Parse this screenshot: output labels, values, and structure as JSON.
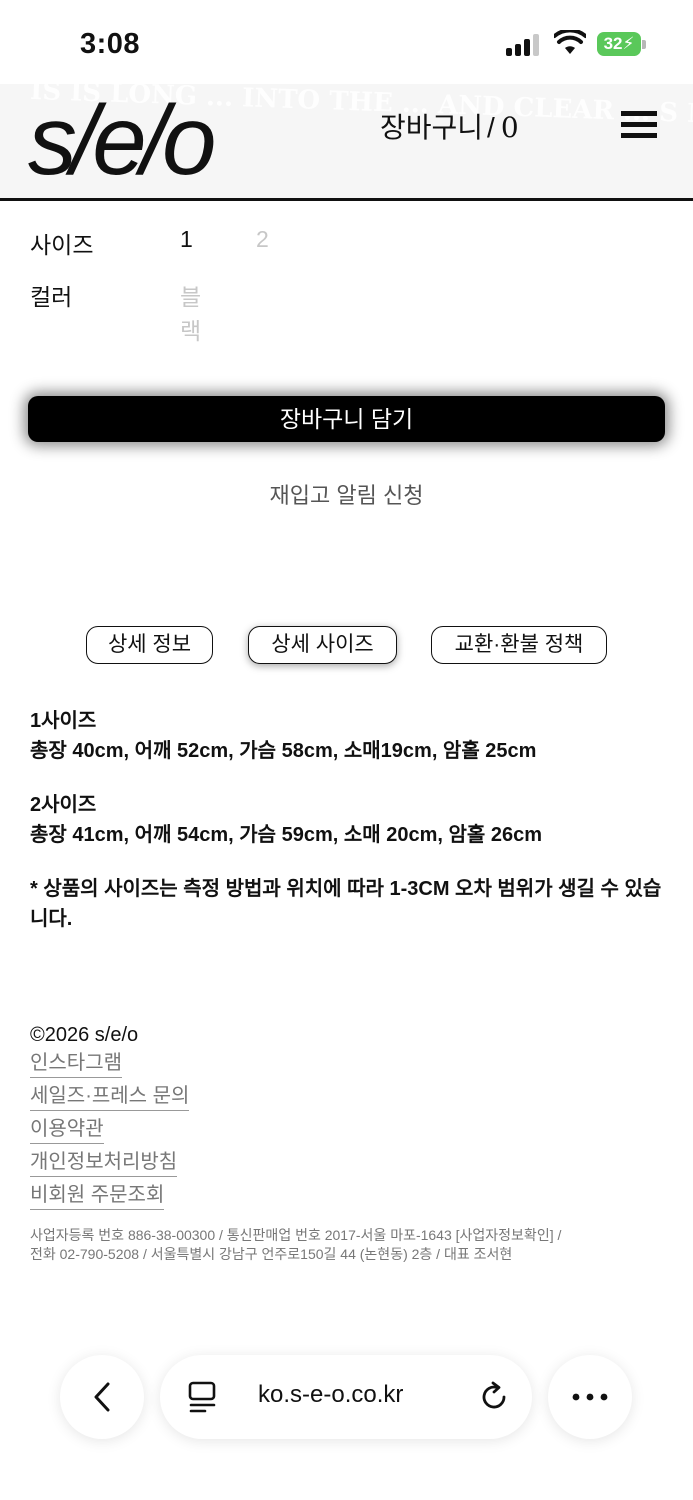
{
  "status_bar": {
    "time": "3:08",
    "battery": "32",
    "battery_color": "#5ac85a",
    "icons": [
      "signal-icon",
      "wifi-icon",
      "battery-icon"
    ]
  },
  "header": {
    "logo": "s/e/o",
    "cart_label": "장바구니",
    "cart_separator": "/",
    "cart_count": "0",
    "background_text": "IS IS LONG ... INTO THE ... AND CLEAR ... S MEANS NOTHI IG MAYBE.",
    "menu_icon": "hamburger-icon"
  },
  "options": {
    "size_label": "사이즈",
    "size_values": [
      "1",
      "2"
    ],
    "color_label": "컬러",
    "color_value": "블랙"
  },
  "actions": {
    "add_to_cart": "장바구니 담기",
    "restock_alert": "재입고 알림 신청"
  },
  "tabs": [
    {
      "label": "상세 정보"
    },
    {
      "label": "상세 사이즈"
    },
    {
      "label": "교환·환불 정책"
    }
  ],
  "size_details": {
    "size1_title": "1사이즈",
    "size1_measure": "총장 40cm, 어깨 52cm, 가슴 58cm, 소매19cm, 암홀 25cm",
    "size2_title": "2사이즈",
    "size2_measure": "총장 41cm, 어깨 54cm, 가슴 59cm, 소매 20cm, 암홀 26cm",
    "note": "* 상품의 사이즈는 측정 방법과 위치에 따라 1-3CM 오차 범위가 생길 수 있습니다."
  },
  "footer": {
    "copyright": "©2026 s/e/o",
    "links": [
      "인스타그램",
      "세일즈·프레스 문의",
      "이용약관",
      "개인정보처리방침",
      "비회원 주문조회"
    ],
    "company_line1": "사업자등록 번호  886-38-00300  / 통신판매업 번호  2017-서울 마포-1643 [사업자정보확인]  /",
    "company_line2": "전화  02-790-5208  / 서울특별시 강남구 언주로150길 44 (논현동) 2층 / 대표  조서현"
  },
  "browser": {
    "url": "ko.s-e-o.co.kr",
    "icons": [
      "back-icon",
      "page-menu-icon",
      "reload-icon",
      "more-icon"
    ]
  }
}
